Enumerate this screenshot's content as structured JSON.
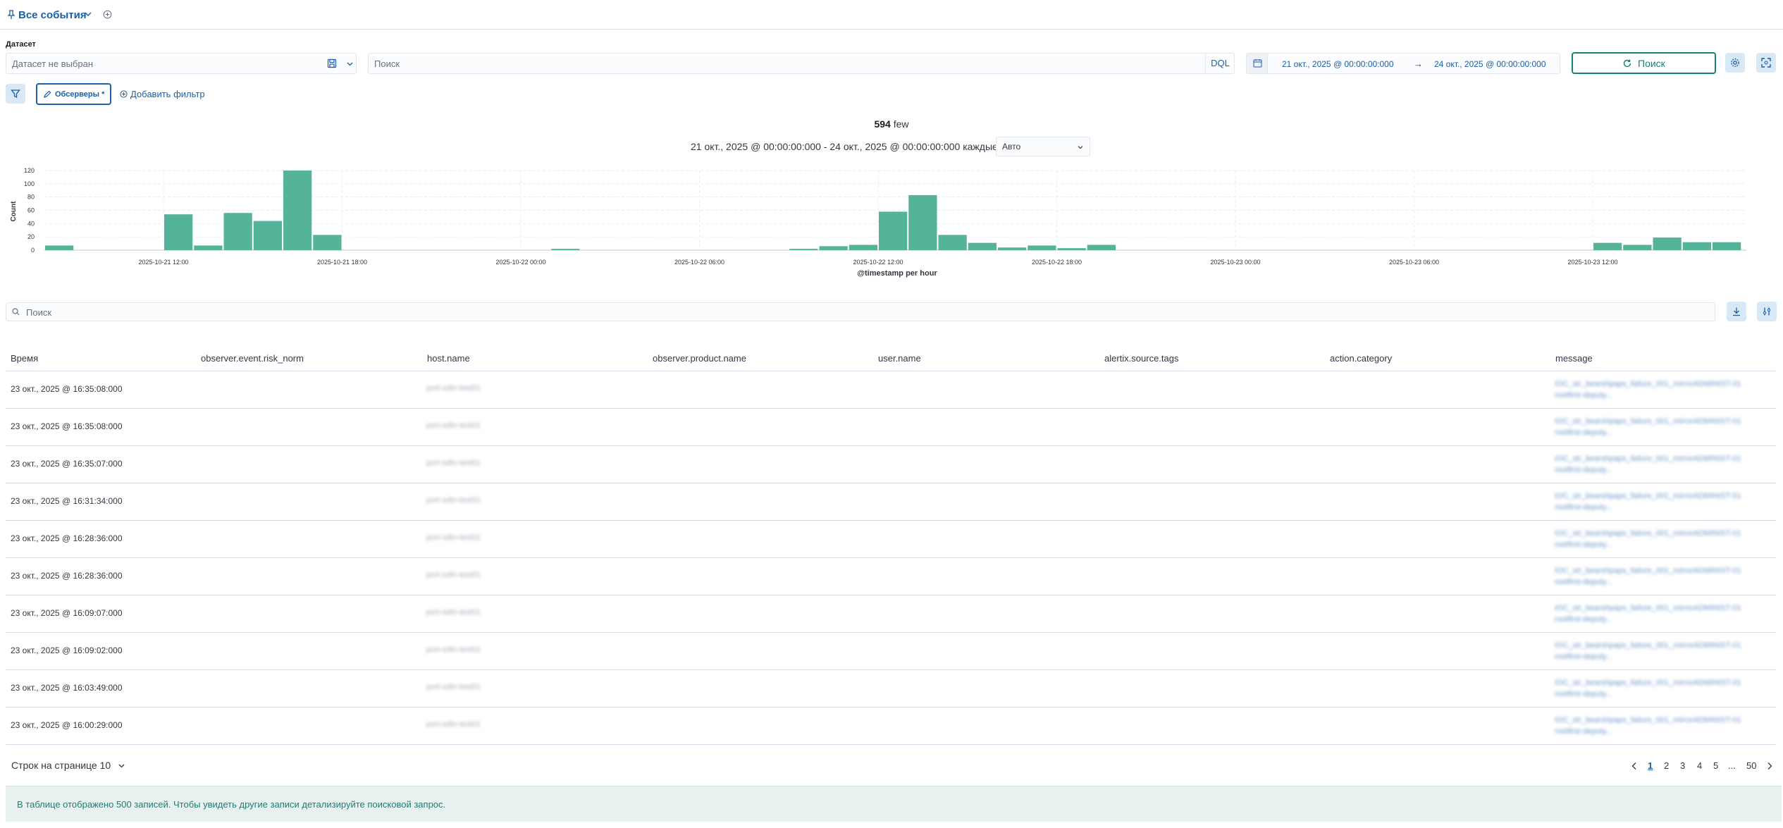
{
  "header": {
    "title": "Все события",
    "pin_icon": "pin-icon",
    "add_tab_icon": "plus-circle-icon"
  },
  "dataset": {
    "label": "Датасет",
    "placeholder": "Датасет не выбран",
    "save_icon": "save-icon"
  },
  "query": {
    "placeholder": "Поиск",
    "language": "DQL"
  },
  "date_range": {
    "start": "21 окт., 2025 @ 00:00:00:000",
    "arrow": "→",
    "end": "24 окт., 2025 @ 00:00:00:000"
  },
  "actions": {
    "search_label": "Поиск",
    "settings_icon": "gear-icon",
    "fullscreen_icon": "fullscreen-icon"
  },
  "filters": {
    "filter_icon": "filter-icon",
    "pill_label": "Обсерверы *",
    "add_filter_label": "Добавить фильтр"
  },
  "histogram": {
    "hits_count": "594",
    "hits_suffix": "few",
    "range_text": "21 окт., 2025 @ 00:00:00:000 - 24 окт., 2025 @ 00:00:00:000 каждые",
    "interval": "Авто"
  },
  "chart_data": {
    "type": "bar",
    "xlabel": "@timestamp per hour",
    "ylabel": "Count",
    "ylim": [
      0,
      120
    ],
    "yticks": [
      0,
      20,
      40,
      60,
      80,
      100,
      120
    ],
    "xtick_labels": [
      "2025-10-21 12:00",
      "2025-10-21 18:00",
      "2025-10-22 00:00",
      "2025-10-22 06:00",
      "2025-10-22 12:00",
      "2025-10-22 18:00",
      "2025-10-23 00:00",
      "2025-10-23 06:00",
      "2025-10-23 12:00"
    ],
    "x_start_hour": 8,
    "x_tick_hours": [
      12,
      18,
      24,
      30,
      36,
      42,
      48,
      54,
      60
    ],
    "bars": [
      {
        "hour": 8,
        "value": 7
      },
      {
        "hour": 12,
        "value": 54
      },
      {
        "hour": 13,
        "value": 7
      },
      {
        "hour": 14,
        "value": 56
      },
      {
        "hour": 15,
        "value": 44
      },
      {
        "hour": 16,
        "value": 120
      },
      {
        "hour": 17,
        "value": 23
      },
      {
        "hour": 25,
        "value": 2
      },
      {
        "hour": 33,
        "value": 2
      },
      {
        "hour": 34,
        "value": 6
      },
      {
        "hour": 35,
        "value": 8
      },
      {
        "hour": 36,
        "value": 58
      },
      {
        "hour": 37,
        "value": 83
      },
      {
        "hour": 38,
        "value": 23
      },
      {
        "hour": 39,
        "value": 11
      },
      {
        "hour": 40,
        "value": 4
      },
      {
        "hour": 41,
        "value": 7
      },
      {
        "hour": 42,
        "value": 3
      },
      {
        "hour": 43,
        "value": 8
      },
      {
        "hour": 60,
        "value": 11
      },
      {
        "hour": 61,
        "value": 8
      },
      {
        "hour": 62,
        "value": 19
      },
      {
        "hour": 63,
        "value": 12
      },
      {
        "hour": 64,
        "value": 12
      }
    ],
    "grid": true,
    "color": "#54b399"
  },
  "table": {
    "search_placeholder": "Поиск",
    "download_icon": "download-icon",
    "columns_icon": "columns-settings-icon",
    "columns": [
      "Время",
      "observer.event.risk_norm",
      "host.name",
      "observer.product.name",
      "user.name",
      "alertix.source.tags",
      "action.category",
      "message"
    ],
    "rows": [
      {
        "time": "23 окт., 2025 @ 16:35:08:000",
        "host": "port-sdtn-test01",
        "message": "IOC_str_bearshpaps_failure_001_mirrorADMINIST-01 rootfirst-deputy..."
      },
      {
        "time": "23 окт., 2025 @ 16:35:08:000",
        "host": "port-sdtn-test01",
        "message": "IOC_str_bearshpaps_failure_001_mirrorADMINIST-01 rootfirst-deputy..."
      },
      {
        "time": "23 окт., 2025 @ 16:35:07:000",
        "host": "port-sdtn-test01",
        "message": "IOC_str_bearshpaps_failure_001_mirrorADMINIST-01 rootfirst-deputy..."
      },
      {
        "time": "23 окт., 2025 @ 16:31:34:000",
        "host": "port-sdtn-test01",
        "message": "IOC_str_bearshpaps_failure_001_mirrorADMINIST-01 rootfirst-deputy..."
      },
      {
        "time": "23 окт., 2025 @ 16:28:36:000",
        "host": "port-sdtn-test01",
        "message": "IOC_str_bearshpaps_failure_001_mirrorADMINIST-01 rootfirst-deputy..."
      },
      {
        "time": "23 окт., 2025 @ 16:28:36:000",
        "host": "port-sdtn-test01",
        "message": "IOC_str_bearshpaps_failure_001_mirrorADMINIST-01 rootfirst-deputy..."
      },
      {
        "time": "23 окт., 2025 @ 16:09:07:000",
        "host": "port-sdtn-test01",
        "message": "IOC_str_bearshpaps_failure_001_mirrorADMINIST-01 rootfirst-deputy..."
      },
      {
        "time": "23 окт., 2025 @ 16:09:02:000",
        "host": "port-sdtn-test01",
        "message": "IOC_str_bearshpaps_failure_001_mirrorADMINIST-01 rootfirst-deputy..."
      },
      {
        "time": "23 окт., 2025 @ 16:03:49:000",
        "host": "port-sdtn-test01",
        "message": "IOC_str_bearshpaps_failure_001_mirrorADMINIST-01 rootfirst-deputy..."
      },
      {
        "time": "23 окт., 2025 @ 16:00:29:000",
        "host": "port-sdtn-test01",
        "message": "IOC_str_bearshpaps_failure_001_mirrorADMINIST-01 rootfirst-deputy..."
      }
    ]
  },
  "pagination": {
    "rows_per_page": "Строк на странице 10",
    "pages": [
      "1",
      "2",
      "3",
      "4",
      "5",
      "...",
      "50"
    ],
    "active_page": "1"
  },
  "notice": {
    "text": "В таблице отображено 500 записей. Чтобы увидеть другие записи детализируйте поисковой запрос."
  }
}
